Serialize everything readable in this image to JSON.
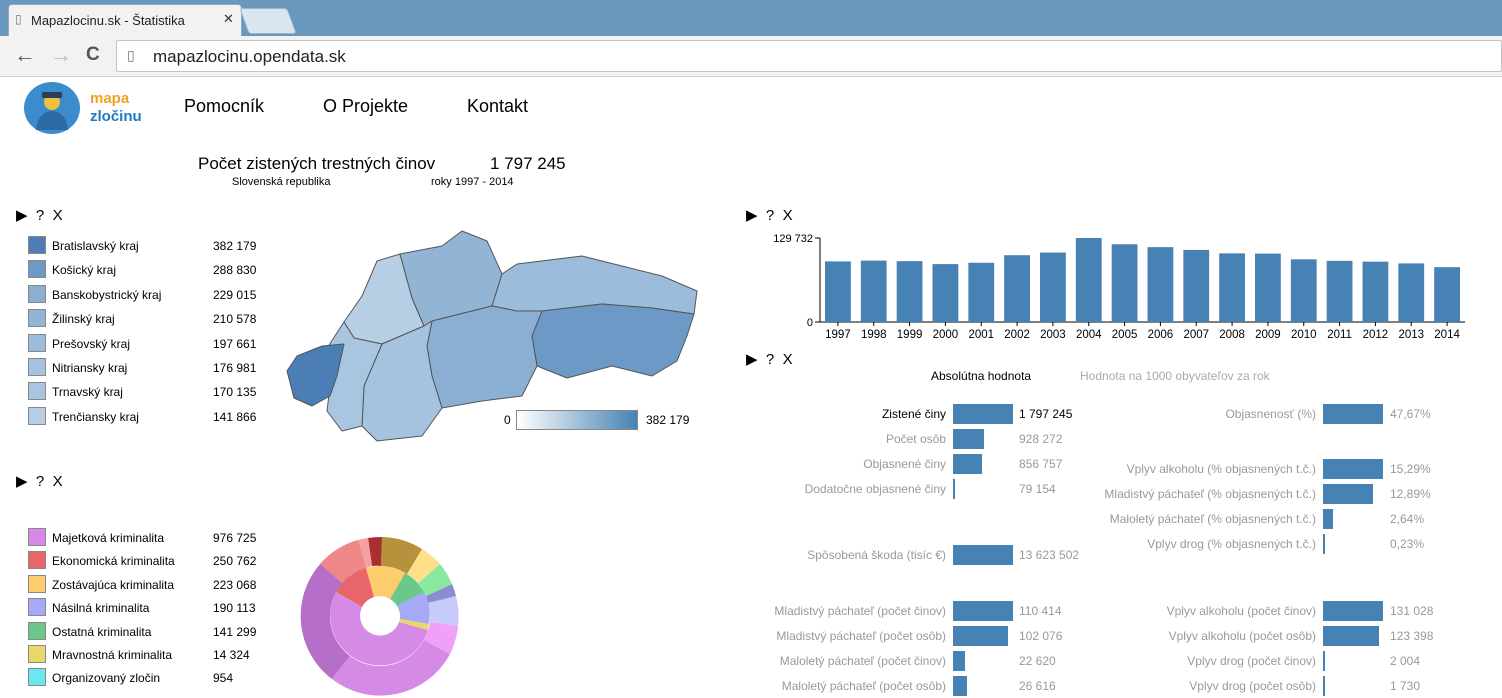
{
  "browser": {
    "tab_title": "Mapazlocinu.sk - Štatistika",
    "tab_close": "✕",
    "back": "←",
    "forward": "→",
    "reload": "C",
    "url": "mapazlocinu.opendata.sk"
  },
  "site": {
    "logo_line1": "mapa",
    "logo_line2": "zločinu",
    "nav": [
      "Pomocník",
      "O Projekte",
      "Kontakt"
    ]
  },
  "summary": {
    "title": "Počet zistených trestných činov",
    "total": "1 797 245",
    "region": "Slovenská republika",
    "years": "roky 1997 - 2014"
  },
  "controls": {
    "play": "▶",
    "help": "?",
    "close": "X"
  },
  "regions": {
    "items": [
      {
        "name": "Bratislavský kraj",
        "value": "382 179",
        "color": "#4a7eb5"
      },
      {
        "name": "Košický kraj",
        "value": "288 830",
        "color": "#6c99c5"
      },
      {
        "name": "Banskobystrický kraj",
        "value": "229 015",
        "color": "#8aafd2"
      },
      {
        "name": "Žilinský kraj",
        "value": "210 578",
        "color": "#92b5d6"
      },
      {
        "name": "Prešovský kraj",
        "value": "197 661",
        "color": "#9bbcda"
      },
      {
        "name": "Nitriansky kraj",
        "value": "176 981",
        "color": "#a5c3de"
      },
      {
        "name": "Trnavský kraj",
        "value": "170 135",
        "color": "#a9c6e0"
      },
      {
        "name": "Trenčiansky kraj",
        "value": "141 866",
        "color": "#b6cfe5"
      }
    ],
    "scale_min": "0",
    "scale_max": "382 179"
  },
  "categories": {
    "items": [
      {
        "name": "Majetková kriminalita",
        "value": "976 725",
        "color": "#d58ae6"
      },
      {
        "name": "Ekonomická kriminalita",
        "value": "250 762",
        "color": "#e8666a"
      },
      {
        "name": "Zostávajúca kriminalita",
        "value": "223 068",
        "color": "#fdcc6c"
      },
      {
        "name": "Násilná kriminalita",
        "value": "190 113",
        "color": "#a5a9f8"
      },
      {
        "name": "Ostatná kriminalita",
        "value": "141 299",
        "color": "#6cc88a"
      },
      {
        "name": "Mravnostná kriminalita",
        "value": "14 324",
        "color": "#e8d86a"
      },
      {
        "name": "Organizovaný zločin",
        "value": "954",
        "color": "#6ae8f0"
      }
    ]
  },
  "chart_data": {
    "type": "bar",
    "categories": [
      "1997",
      "1998",
      "1999",
      "2000",
      "2001",
      "2002",
      "2003",
      "2004",
      "2005",
      "2006",
      "2007",
      "2008",
      "2009",
      "2010",
      "2011",
      "2012",
      "2013",
      "2014"
    ],
    "values": [
      93600,
      94800,
      94000,
      89400,
      91500,
      103200,
      107300,
      129732,
      120000,
      115600,
      111300,
      106000,
      105600,
      96800,
      94500,
      93200,
      90500,
      84700
    ],
    "ylim": [
      0,
      129732
    ],
    "ytick_labels": [
      "0",
      "129 732"
    ],
    "color": "#4682b4"
  },
  "stats": {
    "tab_active": "Absolútna hodnota",
    "tab_inactive": "Hodnota na 1000 obyvateľov za rok",
    "left": [
      {
        "label": "Zistené činy",
        "value": "1 797 245",
        "fraction": 1.0,
        "highlight": true
      },
      {
        "label": "Počet osôb",
        "value": "928 272",
        "fraction": 0.52
      },
      {
        "label": "Objasnené činy",
        "value": "856 757",
        "fraction": 0.48
      },
      {
        "label": "Dodatočne objasnené činy",
        "value": "79 154",
        "fraction": 0.04
      }
    ],
    "damage": {
      "label": "Spôsobená škoda (tisíc €)",
      "value": "13 623 502",
      "fraction": 1.0
    },
    "right": [
      {
        "label": "Objasnenosť (%)",
        "value": "47,67%",
        "fraction": 1.0
      },
      {
        "label": "Vplyv alkoholu (% objasnených t.č.)",
        "value": "15,29%",
        "fraction": 1.0
      },
      {
        "label": "Mladistvý páchateľ (% objasnených t.č.)",
        "value": "12,89%",
        "fraction": 0.84
      },
      {
        "label": "Maloletý páchateľ (% objasnených t.č.)",
        "value": "2,64%",
        "fraction": 0.17
      },
      {
        "label": "Vplyv drog (% objasnených t.č.)",
        "value": "0,23%",
        "fraction": 0.02
      }
    ],
    "bottom_left": [
      {
        "label": "Mladistvý páchateľ (počet činov)",
        "value": "110 414",
        "fraction": 1.0
      },
      {
        "label": "Mladistvý páchateľ (počet osôb)",
        "value": "102 076",
        "fraction": 0.92
      },
      {
        "label": "Maloletý páchateľ (počet činov)",
        "value": "22 620",
        "fraction": 0.2
      },
      {
        "label": "Maloletý páchateľ (počet osôb)",
        "value": "26 616",
        "fraction": 0.24
      }
    ],
    "bottom_right": [
      {
        "label": "Vplyv alkoholu (počet činov)",
        "value": "131 028",
        "fraction": 1.0
      },
      {
        "label": "Vplyv alkoholu (počet osôb)",
        "value": "123 398",
        "fraction": 0.94
      },
      {
        "label": "Vplyv drog (počet činov)",
        "value": "2 004",
        "fraction": 0.02
      },
      {
        "label": "Vplyv drog (počet osôb)",
        "value": "1 730",
        "fraction": 0.01
      }
    ]
  }
}
